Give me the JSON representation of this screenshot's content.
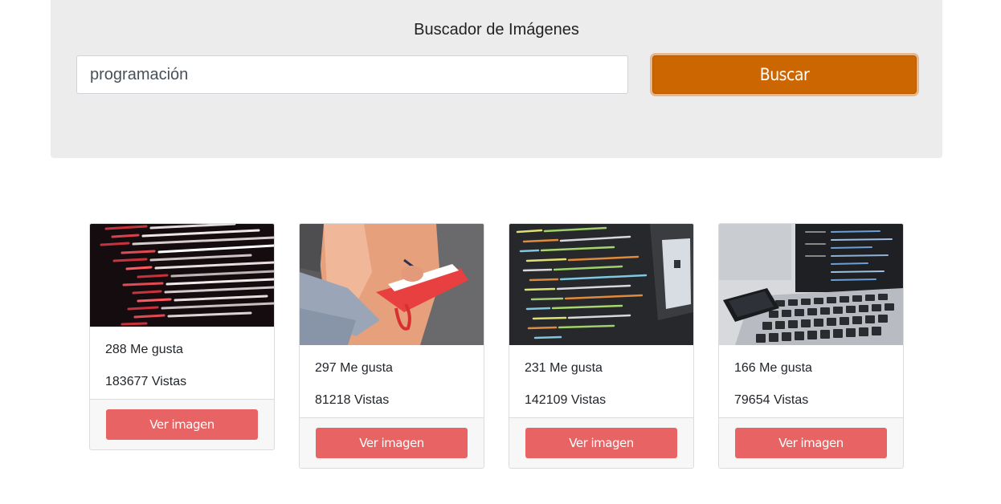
{
  "header": {
    "title": "Buscador de Imágenes",
    "search_value": "programación",
    "search_button": "Buscar"
  },
  "results": [
    {
      "likes": "288 Me gusta",
      "views": "183677 Vistas",
      "button": "Ver imagen",
      "image_subject": "code-on-dark-screen-red"
    },
    {
      "likes": "297 Me gusta",
      "views": "81218 Vistas",
      "button": "Ver imagen",
      "image_subject": "person-writing-in-notebook"
    },
    {
      "likes": "231 Me gusta",
      "views": "142109 Vistas",
      "button": "Ver imagen",
      "image_subject": "code-on-monitor"
    },
    {
      "likes": "166 Me gusta",
      "views": "79654 Vistas",
      "button": "Ver imagen",
      "image_subject": "laptop-and-phone"
    }
  ],
  "colors": {
    "accent": "#cc6600",
    "card_button": "#e86464",
    "jumbotron": "#ececec"
  }
}
